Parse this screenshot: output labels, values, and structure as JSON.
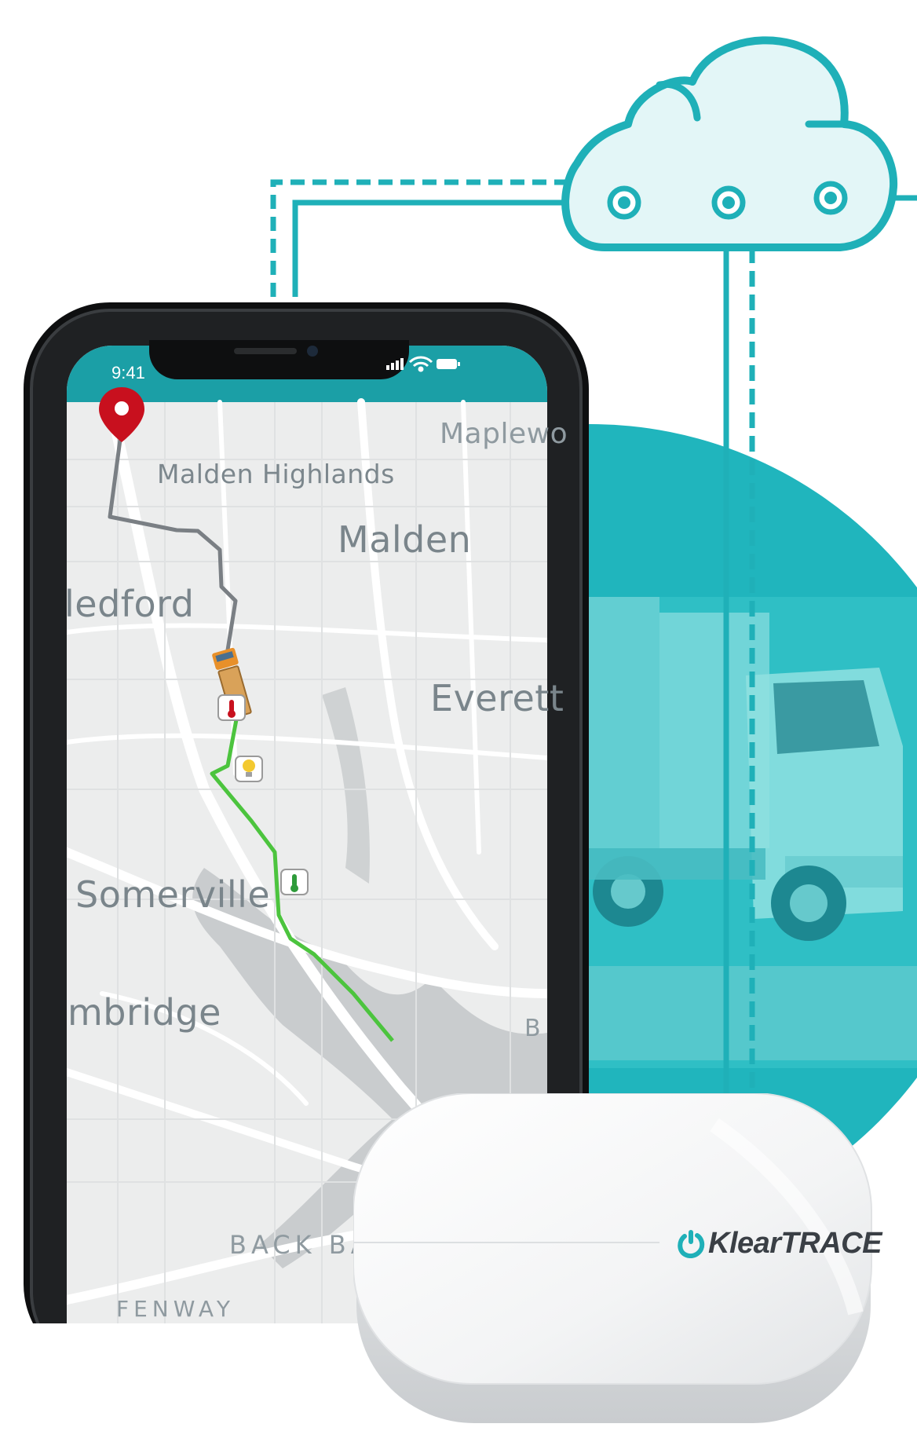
{
  "phone": {
    "status_time": "9:41",
    "map_labels": {
      "maplewood": "Maplewo",
      "malden_highlands": "Malden Highlands",
      "malden": "Malden",
      "medford": "ledford",
      "everett": "Everett",
      "somerville": "Somerville",
      "cambridge": "mbridge",
      "back_bay": "BACK BA",
      "fenway": "FENWAY",
      "b_edge": "B"
    }
  },
  "device": {
    "brand": "KlearTRACE"
  },
  "colors": {
    "teal": "#1fb0b8",
    "cloud_fill": "#e3f6f7",
    "route_done": "#4cc43e",
    "route_pending": "#7a7f84",
    "pin": "#c8101e",
    "truck_marker": "#e8902a"
  },
  "icons": [
    "location-pin-icon",
    "truck-marker-icon",
    "thermometer-red-icon",
    "lightbulb-icon",
    "thermometer-green-icon",
    "signal-icon",
    "wifi-icon",
    "battery-icon",
    "power-icon",
    "cloud-icon"
  ]
}
